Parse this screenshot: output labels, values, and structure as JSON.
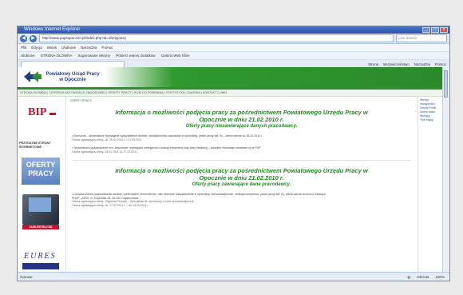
{
  "window": {
    "title": "Windows Internet Explorer",
    "controls": [
      "_",
      "□",
      "x"
    ]
  },
  "address_bar": {
    "url": "http://www.pupsopoczno.pl/index.php?id=ofertypracy",
    "search_placeholder": "Live Search"
  },
  "menu": [
    "Plik",
    "Edycja",
    "Widok",
    "Ulubione",
    "Narzędzia",
    "Pomoc"
  ],
  "favorites_bar": [
    "Ulubione",
    "STRONA GŁÓWNA",
    "Sugerowane witryny",
    "Pobierz więcej dodatków",
    "Galeria Web Slice"
  ],
  "command_bar": {
    "tab_label": "",
    "items": [
      "Strona",
      "Bezpieczeństwo",
      "Narzędzia",
      "Pomoc"
    ]
  },
  "site": {
    "title_line1": "Powiatowy Urząd Pracy",
    "title_line2": "w Opocznie",
    "nav": "STRONA GŁÓWNA | CENTRUM AKTYWIZACJI ZAWODOWEJ | OFERTY PRACY | PLIKI DO POBRANIA | STATYSTYKA | GALERIA | KONTAKT | LINKI",
    "left": {
      "bip": "BIP",
      "przydatne_line1": "PRZYDATNE STRONY",
      "przydatne_line2": "INTERNETOWE",
      "oferty_line1": "OFERTY",
      "oferty_line2": "PRACY",
      "zarejestruj": "ZAREJESTRUJ SIĘ",
      "eures": "EURES"
    },
    "right_links": [
      "Wersja dostępności",
      "Szkoły Profili",
      "Zmień hasło",
      "Wyloguj",
      "Tryb edycji"
    ],
    "breadcrumb": "OFERTY PRACY",
    "section1": {
      "heading_line1": "Informacja o możliwości podjęcia pracy za pośrednictwem Powiatowego Urzędu Pracy w",
      "heading_line2": "Opocznie w dniu 21.02.2010 r.",
      "subheading": "Oferty pracy niezawierające danych pracodawcy.",
      "para1": "• Ekonomia – sprzedawca (wymagane wykształcenie średnie, doświadczenie zawodowe w sprzedaży, prawo jazdy kat. B) – oferta ważna do 28.02.2010 r.",
      "para1_sub": "Osoba zgłaszająca ofertę: ok. 25.02.2011 r. / 21.03.2011",
      "para2": "• Sprzedawca (wykształcenie min. zawodowe, wymagane umiejętności obsługi komputera oraz kasy fiskalnej) – wszelkie informacje udzielane są w PUP",
      "para2_sub": "Osoba zgłaszająca ofertę: 28.01.2011 do 27.02.2011"
    },
    "section2": {
      "heading_line1": "Informacja o możliwości podjęcia pracy za pośrednictwem Powiatowego Urzędu Pracy w",
      "heading_line2": "Opocznie w dniu 21.02.2010 r.",
      "subheading": "Oferty pracy zawierające dane pracodawcy.",
      "para1": "• Doradca klienta (wykształcenie średnie, preferowane ekonomiczne, mile widziane doświadczenie w sprzedaży, komunikatywność, obsługa komputera, prawo jazdy kat. B), oferta ważna do końca miesiąca",
      "para2": "PHUP „JURA” ul. Kopernika 28, 42-200 Częstochowa",
      "para3": "Osoba zgłaszająca ofertę: Zbigniew Pruszek – Specjalista ds. sprzedaży, e-mail: sprzedaz@jura.pl",
      "para4": "Osoba zgłaszająca ofertę: ok. 17.02.2011 r. – do 19.03.2011 r."
    }
  },
  "status": {
    "left": "Gotowe",
    "zone": "Internet",
    "zoom": "100%"
  }
}
